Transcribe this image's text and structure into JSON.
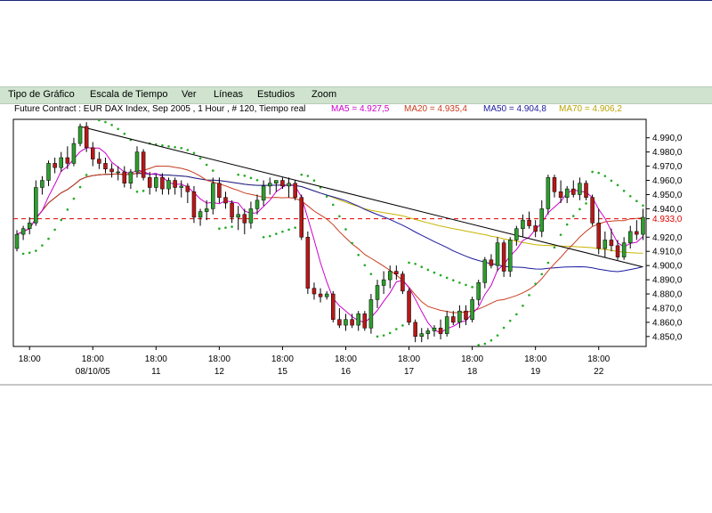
{
  "menu": {
    "items": [
      "Tipo de Gráfico",
      "Escala de Tiempo",
      "Ver",
      "Líneas",
      "Estudios",
      "Zoom"
    ]
  },
  "info": {
    "contract": "Future Contract : EUR DAX Index, Sep 2005 , 1 Hour , # 120, Tiempo real",
    "ma5": "MA5 = 4.927,5",
    "ma20": "MA20 = 4.935,4",
    "ma50": "MA50 = 4.904,8",
    "ma70": "MA70 = 4.906,2"
  },
  "colors": {
    "background": "#ffffff",
    "menubar": "#cfe3cf",
    "candle_up": "#2e9e2e",
    "candle_down": "#b81818",
    "ma5": "#cc00cc",
    "ma20": "#c83c1e",
    "ma50": "#1a1a9e",
    "ma70": "#c8b400",
    "parabolic_sar": "#22aa22",
    "trendline": "#000000",
    "reference_line": "#e00000"
  },
  "chart_data": {
    "type": "candlestick",
    "title": "",
    "xlabel": "",
    "ylabel": "",
    "y_axis_side": "right",
    "ylim": [
      4843,
      5003
    ],
    "y_ticks": [
      "4.850,0",
      "4.860,0",
      "4.870,0",
      "4.880,0",
      "4.890,0",
      "4.900,0",
      "4.910,0",
      "4.920,0",
      "4.933,0",
      "4.940,0",
      "4.950,0",
      "4.960,0",
      "4.970,0",
      "4.980,0",
      "4.990,0"
    ],
    "x_time_labels": [
      "18:00",
      "18:00",
      "18:00",
      "18:00",
      "18:00",
      "18:00",
      "18:00",
      "18:00",
      "18:00",
      "18:00"
    ],
    "x_date_labels": [
      "",
      "08/10/05",
      "11",
      "12",
      "15",
      "16",
      "17",
      "18",
      "19",
      "22"
    ],
    "reference_line": {
      "label": "4.933,0",
      "value": 4933
    },
    "trendline": {
      "from_bar": 10,
      "from_value": 4998,
      "to_bar": 99,
      "to_value": 4899
    },
    "ohlc": [
      [
        4912,
        4925,
        4910,
        4922
      ],
      [
        4922,
        4928,
        4918,
        4926
      ],
      [
        4926,
        4934,
        4922,
        4930
      ],
      [
        4930,
        4960,
        4928,
        4955
      ],
      [
        4955,
        4963,
        4950,
        4960
      ],
      [
        4960,
        4974,
        4956,
        4972
      ],
      [
        4972,
        4976,
        4965,
        4969
      ],
      [
        4969,
        4980,
        4966,
        4976
      ],
      [
        4976,
        4984,
        4968,
        4972
      ],
      [
        4972,
        4990,
        4970,
        4986
      ],
      [
        4986,
        5000,
        4984,
        4998
      ],
      [
        4998,
        5001,
        4980,
        4983
      ],
      [
        4983,
        4987,
        4970,
        4975
      ],
      [
        4975,
        4980,
        4968,
        4972
      ],
      [
        4972,
        4976,
        4965,
        4968
      ],
      [
        4968,
        4972,
        4962,
        4966
      ],
      [
        4966,
        4970,
        4960,
        4966
      ],
      [
        4966,
        4970,
        4955,
        4958
      ],
      [
        4958,
        4968,
        4954,
        4966
      ],
      [
        4966,
        4984,
        4962,
        4980
      ],
      [
        4980,
        4982,
        4960,
        4962
      ],
      [
        4962,
        4966,
        4950,
        4955
      ],
      [
        4955,
        4964,
        4952,
        4962
      ],
      [
        4962,
        4965,
        4950,
        4954
      ],
      [
        4954,
        4962,
        4950,
        4960
      ],
      [
        4960,
        4962,
        4950,
        4955
      ],
      [
        4955,
        4960,
        4948,
        4956
      ],
      [
        4956,
        4958,
        4944,
        4952
      ],
      [
        4952,
        4956,
        4930,
        4934
      ],
      [
        4934,
        4940,
        4928,
        4938
      ],
      [
        4938,
        4946,
        4932,
        4940
      ],
      [
        4940,
        4962,
        4936,
        4958
      ],
      [
        4958,
        4962,
        4944,
        4948
      ],
      [
        4948,
        4952,
        4940,
        4944
      ],
      [
        4944,
        4946,
        4930,
        4934
      ],
      [
        4934,
        4942,
        4925,
        4936
      ],
      [
        4936,
        4940,
        4922,
        4930
      ],
      [
        4930,
        4945,
        4926,
        4940
      ],
      [
        4940,
        4950,
        4936,
        4946
      ],
      [
        4946,
        4960,
        4942,
        4956
      ],
      [
        4956,
        4962,
        4950,
        4958
      ],
      [
        4958,
        4960,
        4952,
        4960
      ],
      [
        4960,
        4962,
        4954,
        4956
      ],
      [
        4956,
        4962,
        4948,
        4958
      ],
      [
        4958,
        4960,
        4946,
        4948
      ],
      [
        4948,
        4950,
        4918,
        4920
      ],
      [
        4920,
        4924,
        4880,
        4884
      ],
      [
        4884,
        4888,
        4876,
        4880
      ],
      [
        4880,
        4884,
        4874,
        4878
      ],
      [
        4878,
        4882,
        4876,
        4880
      ],
      [
        4880,
        4882,
        4860,
        4862
      ],
      [
        4862,
        4870,
        4856,
        4858
      ],
      [
        4858,
        4866,
        4854,
        4862
      ],
      [
        4862,
        4866,
        4856,
        4858
      ],
      [
        4858,
        4868,
        4854,
        4866
      ],
      [
        4866,
        4868,
        4854,
        4856
      ],
      [
        4856,
        4880,
        4852,
        4876
      ],
      [
        4876,
        4890,
        4870,
        4886
      ],
      [
        4886,
        4896,
        4880,
        4890
      ],
      [
        4890,
        4900,
        4884,
        4896
      ],
      [
        4896,
        4900,
        4890,
        4894
      ],
      [
        4894,
        4896,
        4880,
        4882
      ],
      [
        4882,
        4884,
        4858,
        4860
      ],
      [
        4860,
        4862,
        4846,
        4850
      ],
      [
        4850,
        4856,
        4846,
        4852
      ],
      [
        4852,
        4856,
        4848,
        4854
      ],
      [
        4854,
        4858,
        4850,
        4856
      ],
      [
        4856,
        4862,
        4848,
        4852
      ],
      [
        4852,
        4868,
        4850,
        4864
      ],
      [
        4864,
        4868,
        4858,
        4860
      ],
      [
        4860,
        4872,
        4856,
        4868
      ],
      [
        4868,
        4872,
        4858,
        4862
      ],
      [
        4862,
        4878,
        4860,
        4876
      ],
      [
        4876,
        4890,
        4872,
        4888
      ],
      [
        4888,
        4906,
        4884,
        4904
      ],
      [
        4904,
        4908,
        4898,
        4900
      ],
      [
        4900,
        4920,
        4896,
        4916
      ],
      [
        4916,
        4918,
        4892,
        4896
      ],
      [
        4896,
        4920,
        4892,
        4918
      ],
      [
        4918,
        4928,
        4914,
        4926
      ],
      [
        4926,
        4936,
        4920,
        4932
      ],
      [
        4932,
        4938,
        4926,
        4928
      ],
      [
        4928,
        4932,
        4920,
        4924
      ],
      [
        4924,
        4946,
        4920,
        4940
      ],
      [
        4940,
        4964,
        4936,
        4962
      ],
      [
        4962,
        4964,
        4948,
        4952
      ],
      [
        4952,
        4960,
        4944,
        4948
      ],
      [
        4948,
        4956,
        4944,
        4954
      ],
      [
        4954,
        4960,
        4948,
        4950
      ],
      [
        4950,
        4962,
        4946,
        4958
      ],
      [
        4958,
        4960,
        4946,
        4948
      ],
      [
        4948,
        4950,
        4928,
        4930
      ],
      [
        4930,
        4940,
        4908,
        4912
      ],
      [
        4912,
        4924,
        4906,
        4918
      ],
      [
        4918,
        4926,
        4910,
        4914
      ],
      [
        4914,
        4918,
        4904,
        4906
      ],
      [
        4906,
        4920,
        4904,
        4916
      ],
      [
        4916,
        4928,
        4912,
        4924
      ],
      [
        4924,
        4932,
        4918,
        4922
      ],
      [
        4922,
        4940,
        4918,
        4934
      ]
    ],
    "ma_values": [
      {
        "name": "MA5",
        "value": "4.927,5"
      },
      {
        "name": "MA20",
        "value": "4.935,4"
      },
      {
        "name": "MA50",
        "value": "4.904,8"
      },
      {
        "name": "MA70",
        "value": "4.906,2"
      }
    ],
    "grid": false
  }
}
